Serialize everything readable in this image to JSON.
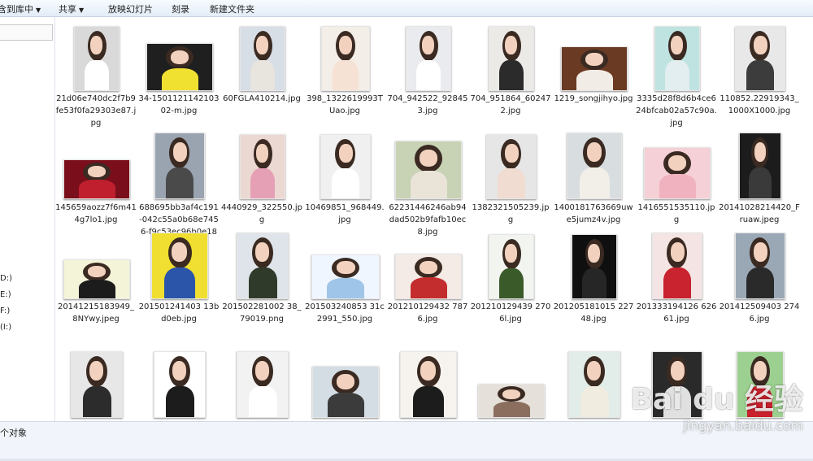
{
  "toolbar": {
    "items": [
      {
        "label": "包含到库中",
        "arrow": "▼"
      },
      {
        "label": "共享",
        "arrow": "▼"
      },
      {
        "label": "放映幻灯片"
      },
      {
        "label": "刻录"
      },
      {
        "label": "新建文件夹"
      }
    ]
  },
  "nav": {
    "drives": [
      "D:)",
      "E:)",
      "F:)",
      "(I:)"
    ]
  },
  "files": [
    {
      "name": "21d06e740dc2f7b9fe53f0fa29303e87.jpg",
      "bg": "#d9d9d9",
      "body": "#ffffff"
    },
    {
      "name": "34-150112114210302-m.jpg",
      "bg": "#1f1f1f",
      "body": "#f0e030"
    },
    {
      "name": "60FGLA410214.jpg",
      "bg": "#d8dee6",
      "body": "#e8e4de"
    },
    {
      "name": "398_1322619993TUao.jpg",
      "bg": "#f4eee8",
      "body": "#f6e2d4"
    },
    {
      "name": "704_942522_928453.jpg",
      "bg": "#e9ebee",
      "body": "#ffffff"
    },
    {
      "name": "704_951864_602472.jpg",
      "bg": "#eceae6",
      "body": "#2b2b2b"
    },
    {
      "name": "1219_songjihyo.jpg",
      "bg": "#6b3a22",
      "body": "#f2ece6"
    },
    {
      "name": "3335d28f8d6b4ce624bfcab02a57c90a.jpg",
      "bg": "#bfe3e0",
      "body": "#e2eef0"
    },
    {
      "name": "110852.22919343_1000X1000.jpg",
      "bg": "#e8e8e8",
      "body": "#3c3c3c"
    },
    {
      "name": "145659aozz7f6m414g7lo1.jpg",
      "bg": "#7a0f1b",
      "body": "#c01f2e"
    },
    {
      "name": "688695bb3af4c191-042c55a0b68e7456-f9c53ec96b0e182564…",
      "bg": "#9aa4b0",
      "body": "#4a4a4a"
    },
    {
      "name": "4440929_322550.jpg",
      "bg": "#ecd8d2",
      "body": "#e6a0b6"
    },
    {
      "name": "10469851_968449.jpg",
      "bg": "#f0f0f0",
      "body": "#ffffff"
    },
    {
      "name": "62231446246ab94dad502b9fafb10ec8.jpg",
      "bg": "#c8d2b4",
      "body": "#e9e3d8"
    },
    {
      "name": "1382321505239.jpg",
      "bg": "#e6e6e6",
      "body": "#f0dcd0"
    },
    {
      "name": "1400181763669uwe5jumz4v.jpg",
      "bg": "#d8dde0",
      "body": "#f2efe9"
    },
    {
      "name": "1416551535110.jpg",
      "bg": "#f5d0d6",
      "body": "#f0b2be"
    },
    {
      "name": "20141028214420_Fruaw.jpeg",
      "bg": "#1c1c1c",
      "body": "#3a3a3a"
    },
    {
      "name": "20141215183949_8NYwy.jpeg",
      "bg": "#f4f4d8",
      "body": "#1c1c1c"
    },
    {
      "name": "201501241403 13bd0eb.jpg",
      "bg": "#f0de30",
      "body": "#2a55a8"
    },
    {
      "name": "201502281002 38_79019.png",
      "bg": "#dfe4ea",
      "body": "#303a2a"
    },
    {
      "name": "201503240853 31c2991_550.jpg",
      "bg": "#f0f6ff",
      "body": "#9fc6e8"
    },
    {
      "name": "201210129432 7876.jpg",
      "bg": "#f4ebe6",
      "body": "#c42d2d"
    },
    {
      "name": "201210129439 2706l.jpg",
      "bg": "#f2f4f0",
      "body": "#3b5a2a"
    },
    {
      "name": "201205181015 22748.jpg",
      "bg": "#0f0f0f",
      "body": "#262626"
    },
    {
      "name": "201333194126 62661.jpg",
      "bg": "#f4e4e4",
      "body": "#c8232e"
    },
    {
      "name": "201412509403 2746.jpg",
      "bg": "#9aa8b6",
      "body": "#2a2a2a"
    },
    {
      "name": "",
      "bg": "#e7e7e7",
      "body": "#2c2c2c"
    },
    {
      "name": "",
      "bg": "#ffffff",
      "body": "#1c1c1c"
    },
    {
      "name": "",
      "bg": "#f2f2f2",
      "body": "#ffffff"
    },
    {
      "name": "",
      "bg": "#d4dde4",
      "body": "#3b3b3b"
    },
    {
      "name": "",
      "bg": "#f6f2ee",
      "body": "#1c1c1c"
    },
    {
      "name": "",
      "bg": "#e6e0da",
      "body": "#8c6e5e"
    },
    {
      "name": "",
      "bg": "#e2ece8",
      "body": "#f0ece0"
    },
    {
      "name": "",
      "bg": "#2a2a2a",
      "body": "#e0e0e0"
    },
    {
      "name": "",
      "bg": "#9cd090",
      "body": "#c8202c"
    }
  ],
  "status": {
    "text": "个对象"
  },
  "watermark": {
    "logo": "Bai du 经验",
    "url": "jingyan.baidu.com"
  }
}
